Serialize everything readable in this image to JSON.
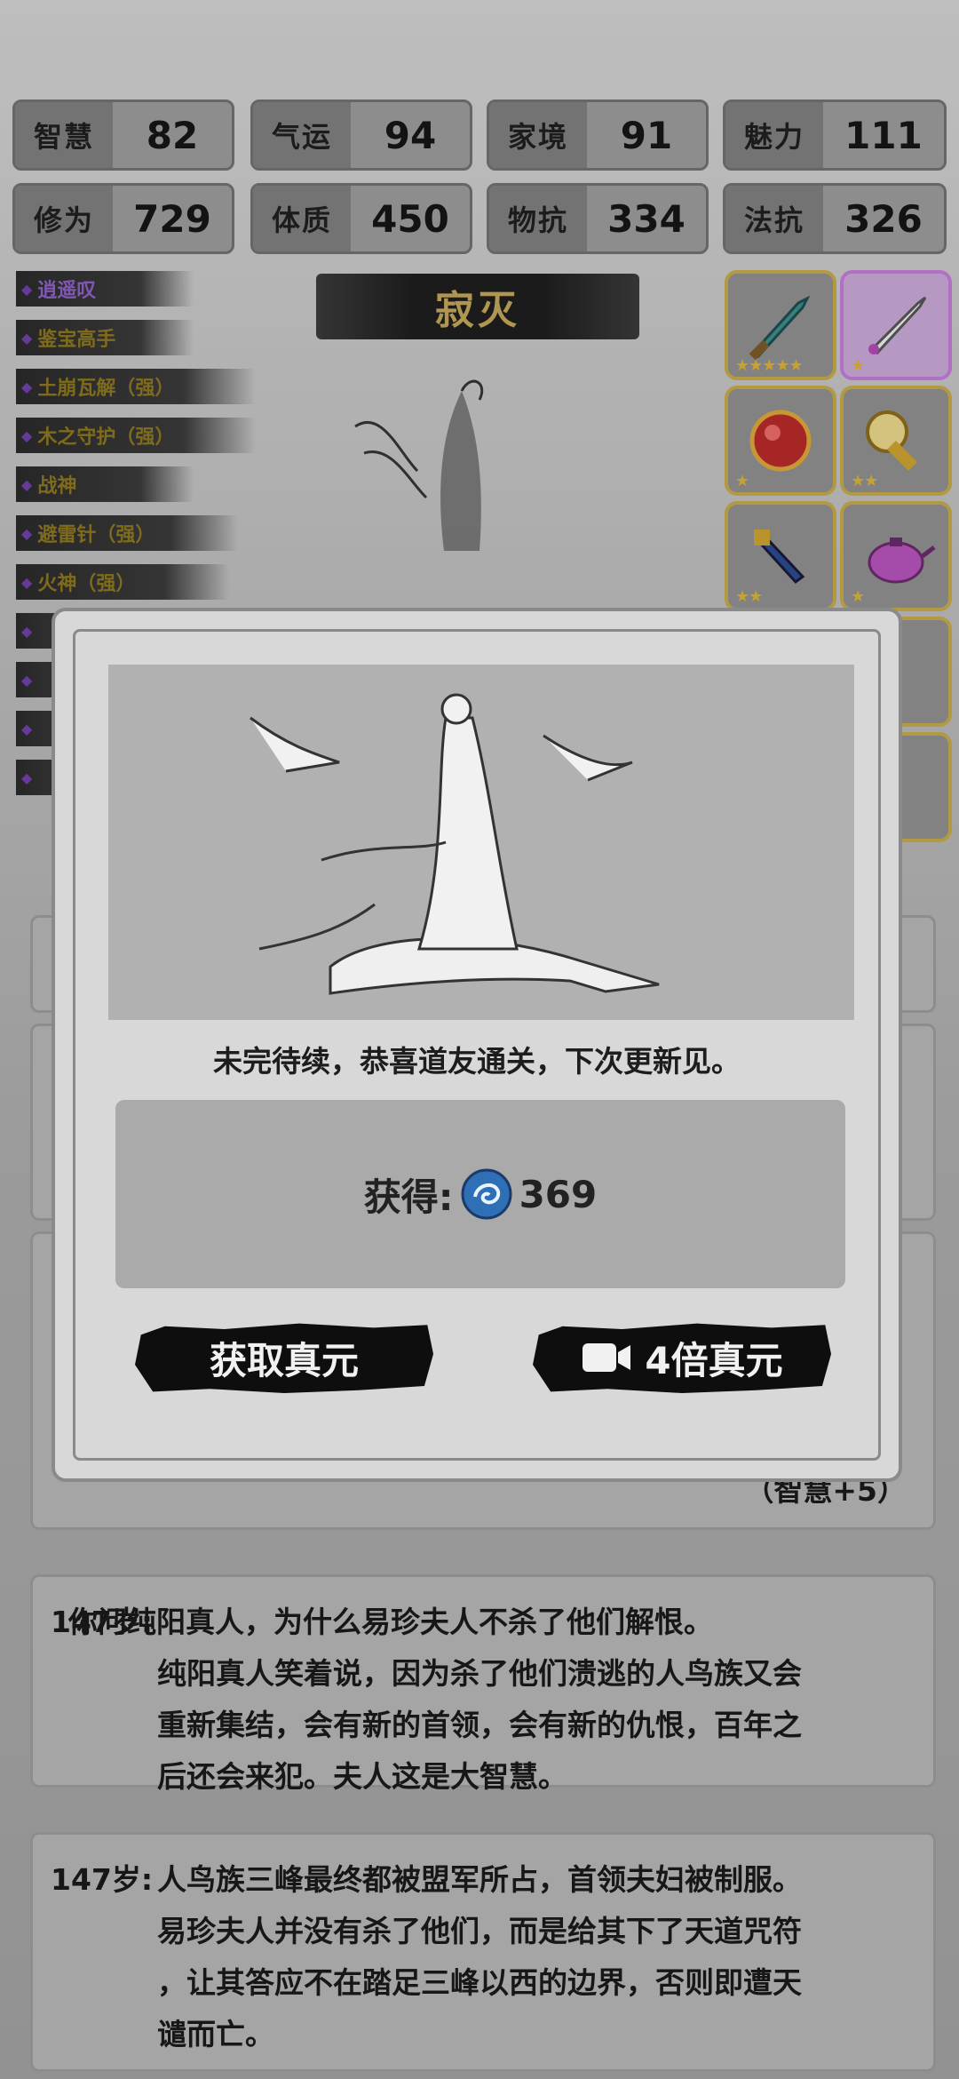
{
  "stats": [
    {
      "label": "智慧",
      "value": "82"
    },
    {
      "label": "气运",
      "value": "94"
    },
    {
      "label": "家境",
      "value": "91"
    },
    {
      "label": "魅力",
      "value": "111"
    },
    {
      "label": "修为",
      "value": "729"
    },
    {
      "label": "体质",
      "value": "450"
    },
    {
      "label": "物抗",
      "value": "334"
    },
    {
      "label": "法抗",
      "value": "326"
    }
  ],
  "skills": [
    "逍遥叹",
    "鉴宝高手",
    "土崩瓦解（强）",
    "木之守护（强）",
    "战神",
    "避雷针（强）",
    "火神（强）"
  ],
  "title_banner": "寂灭",
  "items": [
    {
      "icon": "jade-sword-icon",
      "stars": "★★★★★"
    },
    {
      "icon": "purple-sword-icon",
      "stars": "★"
    },
    {
      "icon": "red-orb-icon",
      "stars": "★"
    },
    {
      "icon": "gold-scepter-icon",
      "stars": "★★"
    },
    {
      "icon": "blue-dagger-icon",
      "stars": "★★"
    },
    {
      "icon": "purple-teapot-icon",
      "stars": "★"
    }
  ],
  "modal": {
    "message": "未完待续，恭喜道友通关，下次更新见。",
    "reward_label": "获得:",
    "reward_value": "369",
    "btn_get": "获取真元",
    "btn_4x": "4倍真元"
  },
  "card_partial": "（智慧+5）",
  "story": [
    {
      "age": "147岁:",
      "lines": [
        "你问纯阳真人，为什么易珍夫人不杀了他们解恨。",
        "纯阳真人笑着说，因为杀了他们溃逃的人鸟族又会",
        "重新集结，会有新的首领，会有新的仇恨，百年之",
        "后还会来犯。夫人这是大智慧。"
      ]
    },
    {
      "age": "147岁:",
      "lines": [
        "人鸟族三峰最终都被盟军所占，首领夫妇被制服。",
        "易珍夫人并没有杀了他们，而是给其下了天道咒符",
        "，让其答应不在踏足三峰以西的边界，否则即遭天",
        "谴而亡。"
      ]
    }
  ]
}
